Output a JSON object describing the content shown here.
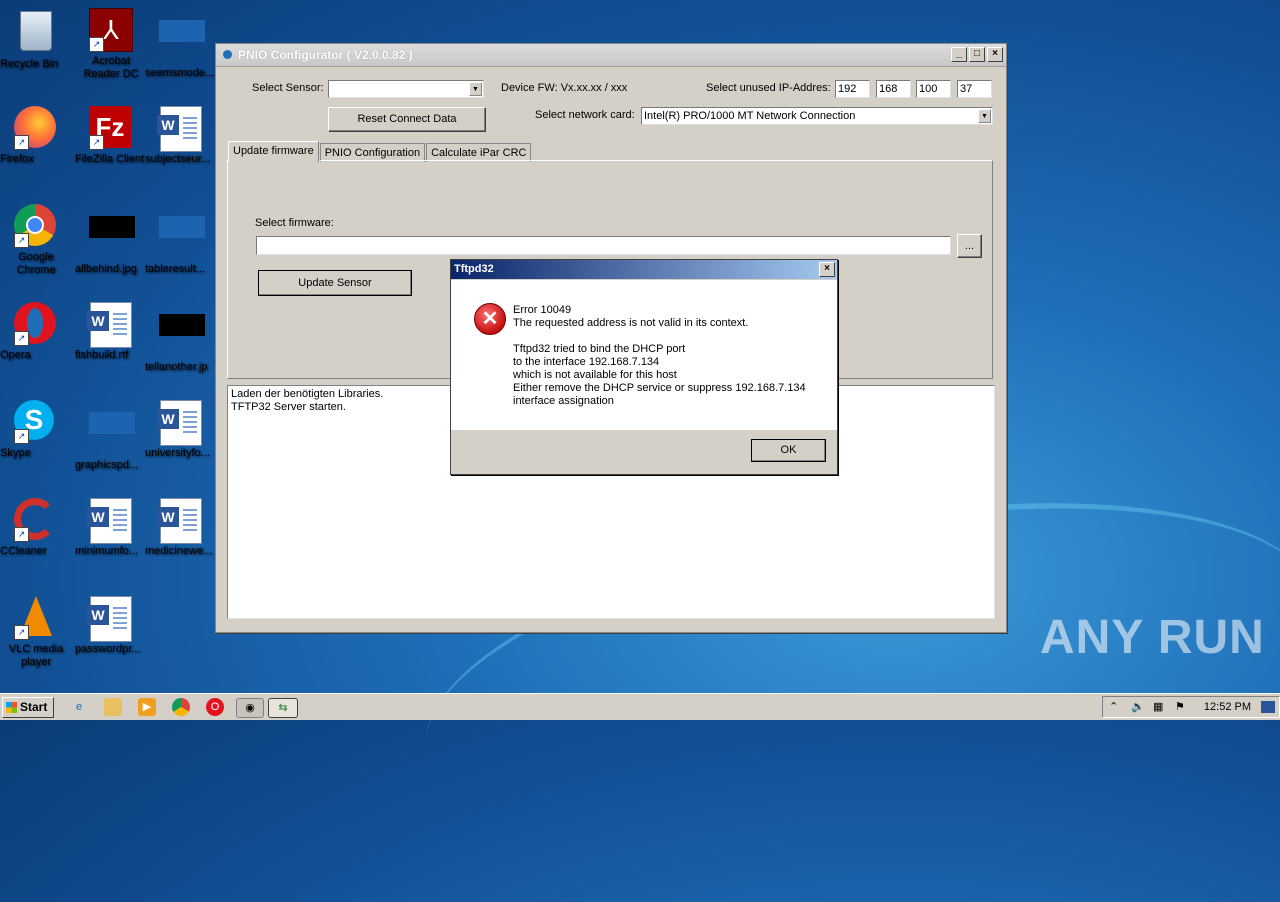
{
  "desktop": {
    "icons": [
      {
        "label": "Recycle Bin"
      },
      {
        "label": "Acrobat Reader DC"
      },
      {
        "label": "seemsmode..."
      },
      {
        "label": "Firefox"
      },
      {
        "label": "FileZilla Client"
      },
      {
        "label": "subjectseur..."
      },
      {
        "label": "Google Chrome"
      },
      {
        "label": "allbehind.jpg"
      },
      {
        "label": "tableresult..."
      },
      {
        "label": "Opera"
      },
      {
        "label": "fishbuild.rtf"
      },
      {
        "label": "tellanother.jp"
      },
      {
        "label": "Skype"
      },
      {
        "label": "graphicspd..."
      },
      {
        "label": "universityfo..."
      },
      {
        "label": "CCleaner"
      },
      {
        "label": "minimumfo..."
      },
      {
        "label": "medicinewe..."
      },
      {
        "label": "VLC media player"
      },
      {
        "label": "passwordpr..."
      }
    ],
    "watermark": "ANY RUN"
  },
  "window": {
    "title": "PNIO Configurator ( V2.0.0.82 )",
    "select_sensor_label": "Select Sensor:",
    "select_sensor_value": "",
    "device_fw": "Device FW: Vx.xx.xx / xxx",
    "select_ip_label": "Select unused IP-Addres:",
    "ip": [
      "192",
      "168",
      "100",
      "37"
    ],
    "reset_button": "Reset Connect Data",
    "network_card_label": "Select network card:",
    "network_card_value": "Intel(R) PRO/1000 MT Network Connection",
    "tabs": [
      "Update firmware",
      "PNIO Configuration",
      "Calculate iPar CRC"
    ],
    "select_firmware_label": "Select firmware:",
    "firmware_path": "",
    "browse_button": "...",
    "update_sensor_button": "Update Sensor",
    "log_lines": [
      "Laden der benötigten Libraries.",
      "TFTP32 Server starten."
    ]
  },
  "dialog": {
    "title": "Tftpd32",
    "message": "Error 10049\nThe requested address is not valid in its context.\n\nTftpd32 tried to bind the DHCP port\nto the interface 192.168.7.134\nwhich is not available for this host\nEither remove the DHCP service or suppress 192.168.7.134\ninterface assignation",
    "ok_button": "OK"
  },
  "taskbar": {
    "start_label": "Start",
    "clock": "12:52 PM"
  }
}
